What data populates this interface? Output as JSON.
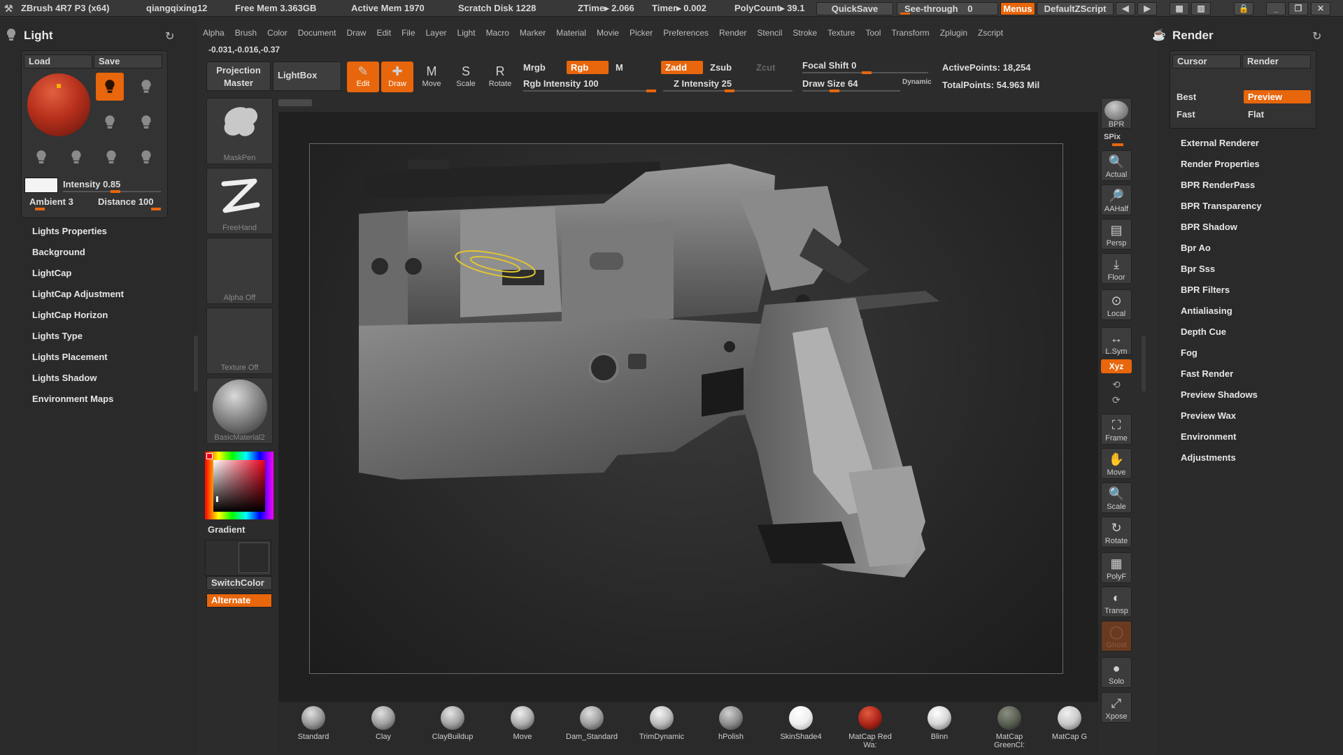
{
  "titlebar": {
    "app": "ZBrush 4R7 P3 (x64)",
    "user": "qiangqixing12",
    "free_mem": "Free Mem 3.363GB",
    "active_mem": "Active Mem 1970",
    "scratch": "Scratch Disk 1228",
    "ztime": "ZTime▸ 2.066",
    "timer": "Timer▸ 0.002",
    "polycount": "PolyCount▸ 39.1",
    "quicksave": "QuickSave",
    "seethrough": "See-through",
    "seethrough_val": "0",
    "menus": "Menus",
    "defaultzscript": "DefaultZScript"
  },
  "menubar": [
    "Alpha",
    "Brush",
    "Color",
    "Document",
    "Draw",
    "Edit",
    "File",
    "Layer",
    "Light",
    "Macro",
    "Marker",
    "Material",
    "Movie",
    "Picker",
    "Preferences",
    "Render",
    "Stencil",
    "Stroke",
    "Texture",
    "Tool",
    "Transform",
    "Zplugin",
    "Zscript"
  ],
  "coords": "-0.031,-0.016,-0.37",
  "light_panel": {
    "title": "Light",
    "load": "Load",
    "save": "Save",
    "intensity_label": "Intensity",
    "intensity_value": "0.85",
    "ambient_label": "Ambient",
    "ambient_value": "3",
    "distance_label": "Distance",
    "distance_value": "100",
    "items": [
      "Lights Properties",
      "Background",
      "LightCap",
      "LightCap Adjustment",
      "LightCap Horizon",
      "Lights Type",
      "Lights Placement",
      "Lights Shadow",
      "Environment Maps"
    ]
  },
  "tool_tiles": {
    "projection": "Projection Master",
    "lightbox": "LightBox",
    "maskpen": "MaskPen",
    "freehand": "FreeHand",
    "alpha": "Alpha  Off",
    "texture": "Texture  Off",
    "material": "BasicMaterial2",
    "gradient": "Gradient",
    "switchcolor": "SwitchColor",
    "alternate": "Alternate"
  },
  "toolbar": {
    "edit": "Edit",
    "draw": "Draw",
    "move": "Move",
    "scale": "Scale",
    "rotate": "Rotate",
    "mrgb": "Mrgb",
    "rgb": "Rgb",
    "m": "M",
    "rgb_intensity_label": "Rgb  Intensity",
    "rgb_intensity_value": "100",
    "zadd": "Zadd",
    "zsub": "Zsub",
    "zcut": "Zcut",
    "z_intensity_label": "Z  Intensity",
    "z_intensity_value": "25",
    "focal_label": "Focal Shift",
    "focal_value": "0",
    "drawsize_label": "Draw Size",
    "drawsize_value": "64",
    "dynamic": "Dynamic",
    "active_points": "ActivePoints: 18,254",
    "total_points": "TotalPoints: 54.963  Mil"
  },
  "right_strip": [
    "BPR",
    "SPix",
    "Actual",
    "AAHalf",
    "Persp",
    "Floor",
    "Local",
    "L.Sym",
    "Xyz",
    "Frame",
    "Move",
    "Scale",
    "Rotate",
    "PolyF",
    "Transp",
    "Ghost",
    "Solo",
    "Xpose"
  ],
  "render_panel": {
    "title": "Render",
    "cursor": "Cursor",
    "render": "Render",
    "best": "Best",
    "preview": "Preview",
    "fast": "Fast",
    "flat": "Flat",
    "items": [
      "External Renderer",
      "Render Properties",
      "BPR RenderPass",
      "BPR Transparency",
      "BPR Shadow",
      "Bpr Ao",
      "Bpr Sss",
      "BPR Filters",
      "Antialiasing",
      "Depth Cue",
      "Fog",
      "Fast Render",
      "Preview Shadows",
      "Preview Wax",
      "Environment",
      "Adjustments"
    ]
  },
  "brushes": [
    {
      "name": "Standard",
      "color": "#9a9a9a"
    },
    {
      "name": "Clay",
      "color": "#a0a0a0"
    },
    {
      "name": "ClayBuildup",
      "color": "#a5a5a5"
    },
    {
      "name": "Move",
      "color": "#b0b0b0"
    },
    {
      "name": "Dam_Standard",
      "color": "#a0a0a0"
    },
    {
      "name": "TrimDynamic",
      "color": "#bdbdbd"
    },
    {
      "name": "hPolish",
      "color": "#8f8f8f"
    },
    {
      "name": "SkinShade4",
      "color": "#efefef"
    },
    {
      "name": "MatCap  Red  Wa:",
      "color": "#b0271b"
    },
    {
      "name": "Blinn",
      "color": "#d6d6d6"
    },
    {
      "name": "MatCap  GreenCl:",
      "color": "#5a6053"
    },
    {
      "name": "MatCap  G",
      "color": "#c9c9c9"
    }
  ],
  "colors": {
    "accent": "#e8660c",
    "material_sphere": "#b8301c"
  }
}
